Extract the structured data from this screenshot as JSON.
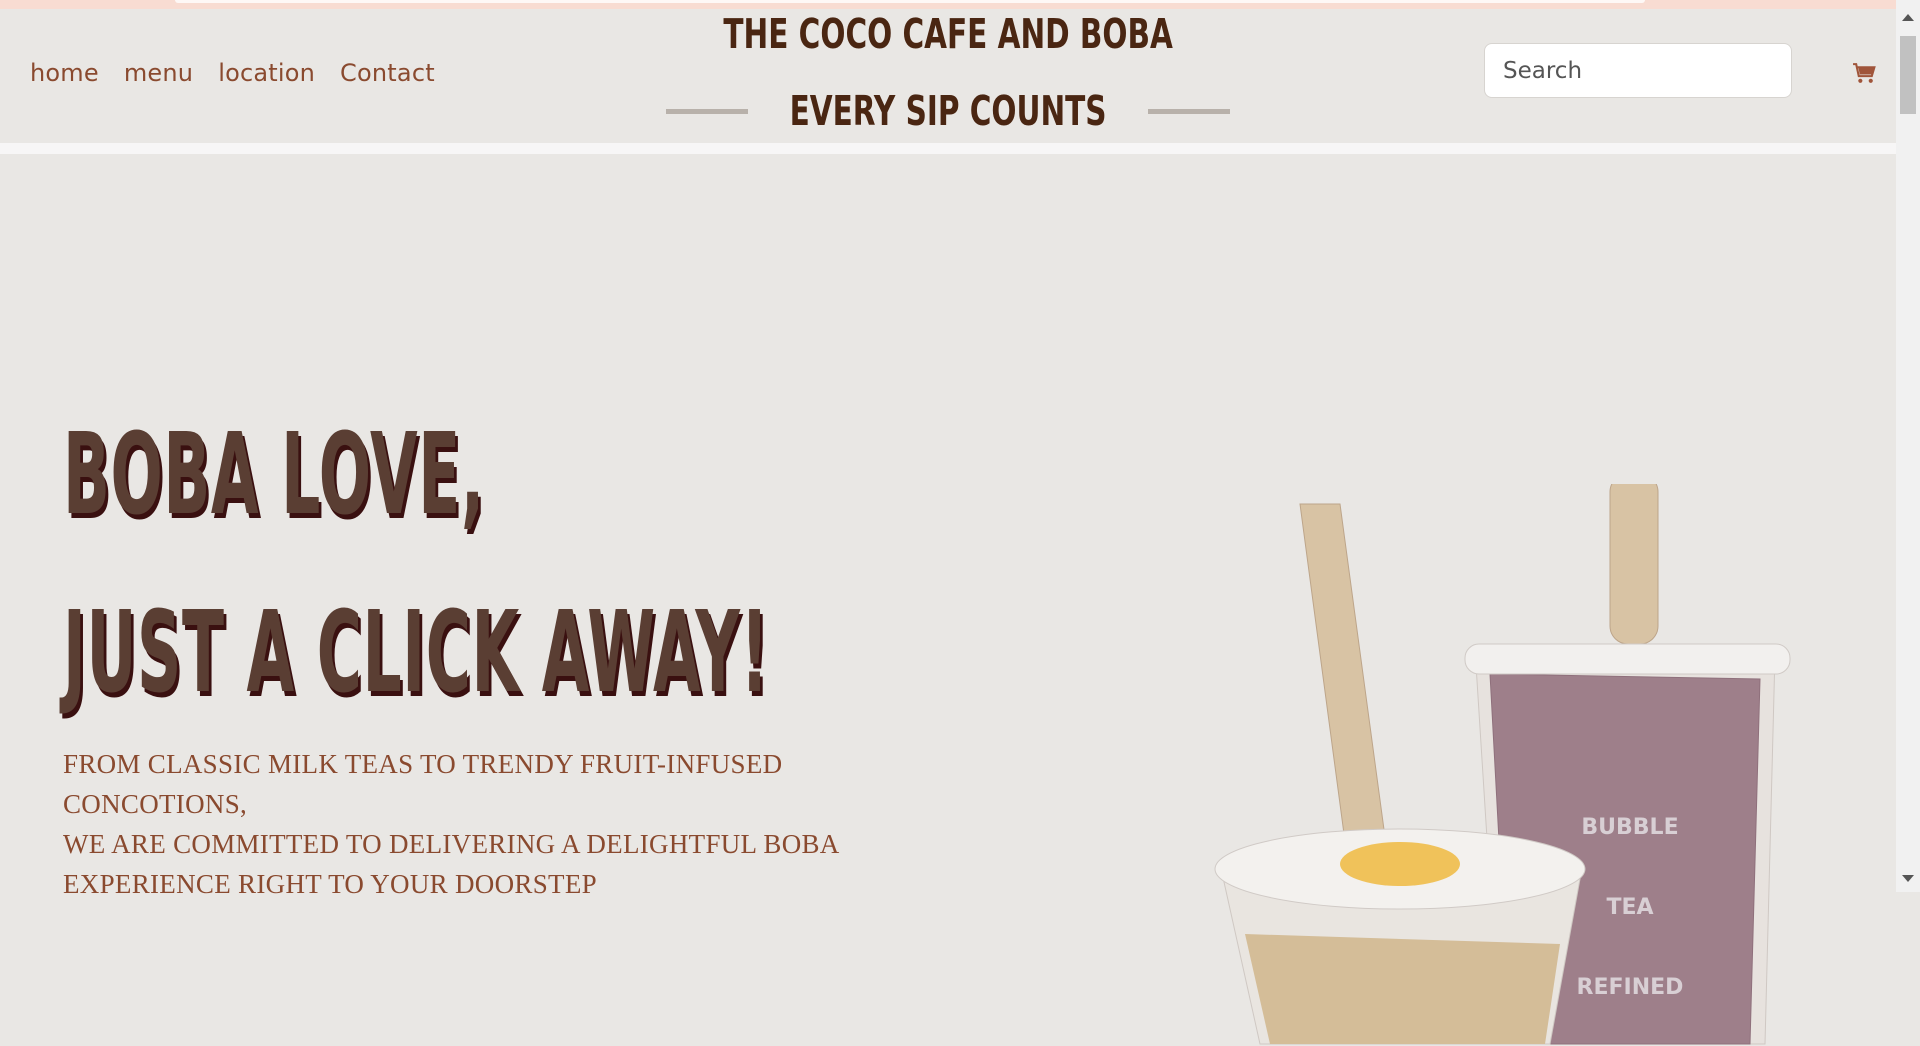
{
  "nav": {
    "items": [
      {
        "label": "home"
      },
      {
        "label": "menu"
      },
      {
        "label": "location"
      },
      {
        "label": "Contact"
      }
    ]
  },
  "brand": {
    "title": "THE COCO CAFE AND BOBA",
    "tagline": "EVERY SIP COUNTS"
  },
  "search": {
    "placeholder": "Search"
  },
  "cart": {
    "icon": "cart-icon"
  },
  "hero": {
    "line1": "BOBA LOVE,",
    "line2": "JUST A CLICK AWAY!",
    "blurb_lines": [
      "FROM CLASSIC MILK TEAS TO TRENDY FRUIT-INFUSED CONCOTIONS,",
      "WE ARE COMMITTED TO DELIVERING A DELIGHTFUL BOBA",
      "EXPERIENCE RIGHT TO YOUR DOORSTEP"
    ],
    "image_alt": "two boba tea cups",
    "cup_lettering": [
      "BUBBLE",
      "TEA",
      "REFINED"
    ]
  },
  "colors": {
    "nav": "#8a4a2f",
    "brand": "#4a2612",
    "background": "#e9e7e4",
    "accent_brown": "#5a3e33",
    "accent_gold": "#a08056",
    "accent_navy": "#3f4a5d",
    "accent_blue": "#1e4690",
    "accent_plum": "#6b3a44"
  }
}
